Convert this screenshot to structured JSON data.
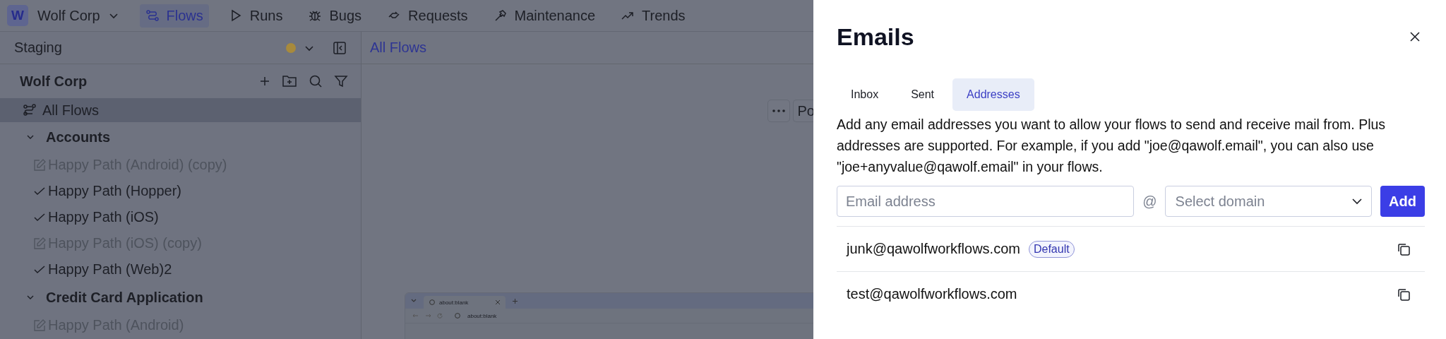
{
  "nav": {
    "workspace": {
      "initial": "W",
      "name": "Wolf Corp"
    },
    "tabs": [
      {
        "label": "Flows",
        "selected": true
      },
      {
        "label": "Runs",
        "selected": false
      },
      {
        "label": "Bugs",
        "selected": false
      },
      {
        "label": "Requests",
        "selected": false
      },
      {
        "label": "Maintenance",
        "selected": false
      },
      {
        "label": "Trends",
        "selected": false
      }
    ]
  },
  "sidebar": {
    "environment": "Staging",
    "tree_title": "Wolf Corp",
    "all_flows": {
      "label": "All Flows",
      "selected": true
    },
    "groups": [
      {
        "name": "Accounts",
        "expanded": true,
        "children": [
          {
            "name": "Happy Path (Android) (copy)",
            "kind": "draft"
          },
          {
            "name": "Happy Path (Hopper)",
            "kind": "passing"
          },
          {
            "name": "Happy Path (iOS)",
            "kind": "passing"
          },
          {
            "name": "Happy Path (iOS) (copy)",
            "kind": "draft"
          },
          {
            "name": "Happy Path (Web)2",
            "kind": "passing"
          }
        ]
      },
      {
        "name": "Credit Card Application",
        "expanded": true,
        "children": [
          {
            "name": "Happy Path (Android)",
            "kind": "draft"
          }
        ]
      }
    ]
  },
  "main": {
    "breadcrumb": "All Flows",
    "partial_button": "Po",
    "browser_preview": {
      "tab_title": "about:blank",
      "address": "about:blank"
    }
  },
  "panel": {
    "title": "Emails",
    "tabs": [
      {
        "label": "Inbox",
        "selected": false
      },
      {
        "label": "Sent",
        "selected": false
      },
      {
        "label": "Addresses",
        "selected": true
      }
    ],
    "description": "Add any email addresses you want to allow your flows to send and receive mail from. Plus addresses are supported. For example, if you add \"joe@qawolf.email\", you can also use \"joe+anyvalue@qawolf.email\" in your flows.",
    "email_field": {
      "placeholder": "Email address"
    },
    "separator": "@",
    "domain_select": {
      "placeholder": "Select domain"
    },
    "add_button": "Add",
    "addresses": [
      {
        "address": "junk@qawolfworkflows.com",
        "badge": "Default"
      },
      {
        "address": "test@qawolfworkflows.com"
      }
    ]
  }
}
